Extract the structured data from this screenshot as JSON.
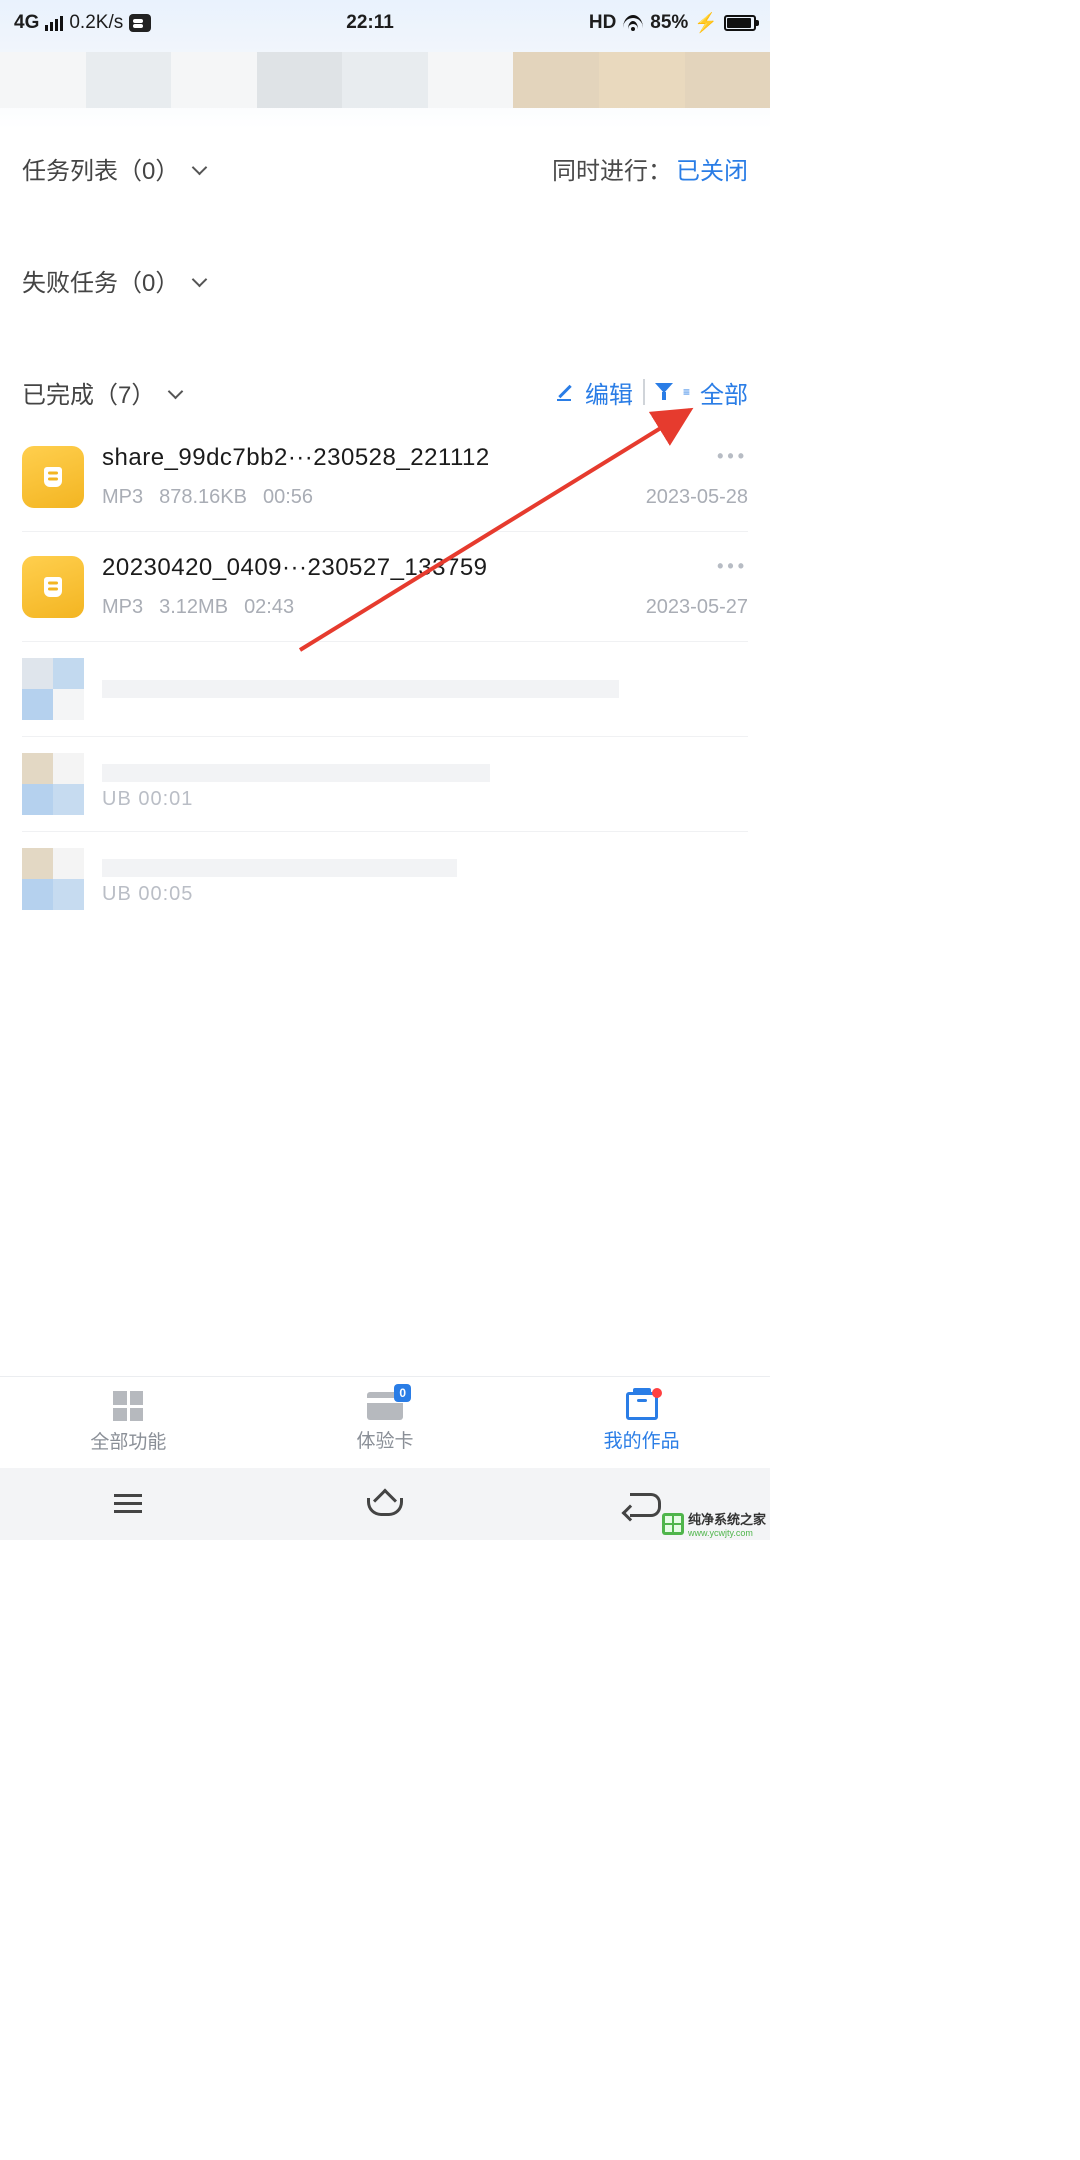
{
  "status_bar": {
    "network": "4G",
    "speed": "0.2K/s",
    "time": "22:11",
    "hd": "HD",
    "battery_pct": "85%",
    "charging": "⚡"
  },
  "sections": {
    "task_list": {
      "label": "任务列表（0）"
    },
    "concurrent": {
      "label": "同时进行：",
      "value": "已关闭"
    },
    "failed": {
      "label": "失败任务（0）"
    },
    "completed": {
      "label": "已完成（7）"
    },
    "edit": "编辑",
    "filter": "全部"
  },
  "files": [
    {
      "name": "share_99dc7bb2···230528_221112",
      "type": "MP3",
      "size": "878.16KB",
      "duration": "00:56",
      "date": "2023-05-28"
    },
    {
      "name": "20230420_0409···230527_133759",
      "type": "MP3",
      "size": "3.12MB",
      "duration": "02:43",
      "date": "2023-05-27"
    }
  ],
  "blurred_meta": [
    "",
    "UB   00:01",
    "UB   00:05"
  ],
  "bottom_nav": {
    "all": "全部功能",
    "trial": "体验卡",
    "trial_badge": "0",
    "works": "我的作品"
  },
  "watermark": {
    "line1": "纯净系统之家",
    "line2": "www.ycwjty.com"
  }
}
